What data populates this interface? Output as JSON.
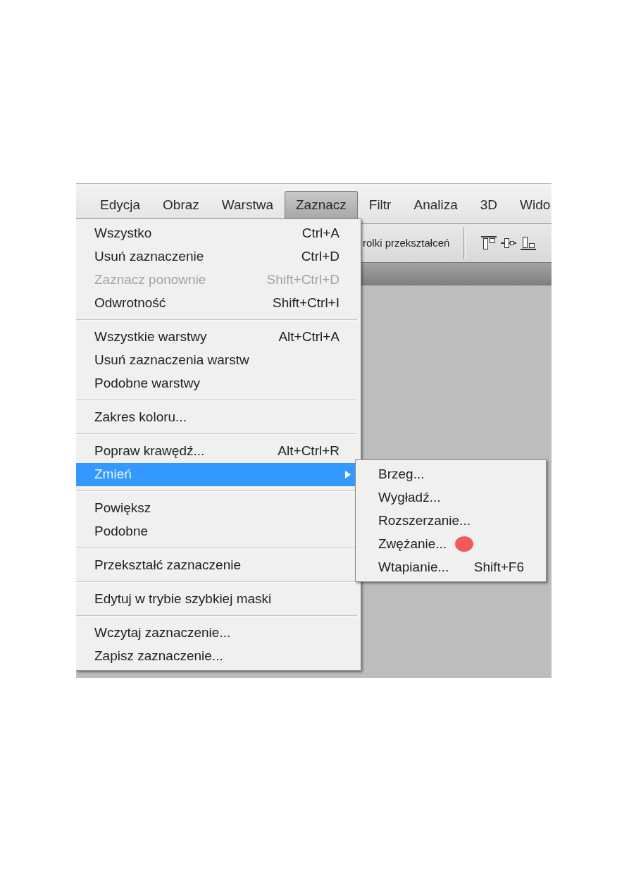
{
  "menubar": {
    "items": [
      {
        "label": "Edycja",
        "selected": false
      },
      {
        "label": "Obraz",
        "selected": false
      },
      {
        "label": "Warstwa",
        "selected": false
      },
      {
        "label": "Zaznacz",
        "selected": true
      },
      {
        "label": "Filtr",
        "selected": false
      },
      {
        "label": "Analiza",
        "selected": false
      },
      {
        "label": "3D",
        "selected": false
      },
      {
        "label": "Wido",
        "selected": false
      }
    ]
  },
  "options_bar": {
    "label": "rolki przekształceń"
  },
  "menu": {
    "sections": [
      {
        "items": [
          {
            "label": "Wszystko",
            "shortcut": "Ctrl+A",
            "disabled": false,
            "selected": false
          },
          {
            "label": "Usuń zaznaczenie",
            "shortcut": "Ctrl+D",
            "disabled": false,
            "selected": false
          },
          {
            "label": "Zaznacz ponownie",
            "shortcut": "Shift+Ctrl+D",
            "disabled": true,
            "selected": false
          },
          {
            "label": "Odwrotność",
            "shortcut": "Shift+Ctrl+I",
            "disabled": false,
            "selected": false
          }
        ]
      },
      {
        "items": [
          {
            "label": "Wszystkie warstwy",
            "shortcut": "Alt+Ctrl+A",
            "disabled": false,
            "selected": false
          },
          {
            "label": "Usuń zaznaczenia warstw",
            "disabled": false,
            "selected": false
          },
          {
            "label": "Podobne warstwy",
            "disabled": false,
            "selected": false
          }
        ]
      },
      {
        "items": [
          {
            "label": "Zakres koloru...",
            "disabled": false,
            "selected": false
          }
        ]
      },
      {
        "items": [
          {
            "label": "Popraw krawędź...",
            "shortcut": "Alt+Ctrl+R",
            "disabled": false,
            "selected": false
          },
          {
            "label": "Zmień",
            "disabled": false,
            "selected": true,
            "submenu": {
              "items": [
                {
                  "label": "Brzeg...",
                  "selected": false,
                  "marked": false
                },
                {
                  "label": "Wygładź...",
                  "selected": false,
                  "marked": false
                },
                {
                  "label": "Rozszerzanie...",
                  "selected": false,
                  "marked": false
                },
                {
                  "label": "Zwężanie...",
                  "selected": false,
                  "marked": true
                },
                {
                  "label": "Wtapianie...",
                  "shortcut": "Shift+F6",
                  "selected": false,
                  "marked": false
                }
              ]
            }
          }
        ]
      },
      {
        "items": [
          {
            "label": "Powiększ",
            "disabled": false,
            "selected": false
          },
          {
            "label": "Podobne",
            "disabled": false,
            "selected": false
          }
        ]
      },
      {
        "items": [
          {
            "label": "Przekształć zaznaczenie",
            "disabled": false,
            "selected": false
          }
        ]
      },
      {
        "items": [
          {
            "label": "Edytuj w trybie szybkiej maski",
            "disabled": false,
            "selected": false
          }
        ]
      },
      {
        "items": [
          {
            "label": "Wczytaj zaznaczenie...",
            "disabled": false,
            "selected": false
          },
          {
            "label": "Zapisz zaznaczenie...",
            "disabled": false,
            "selected": false
          }
        ]
      }
    ]
  }
}
